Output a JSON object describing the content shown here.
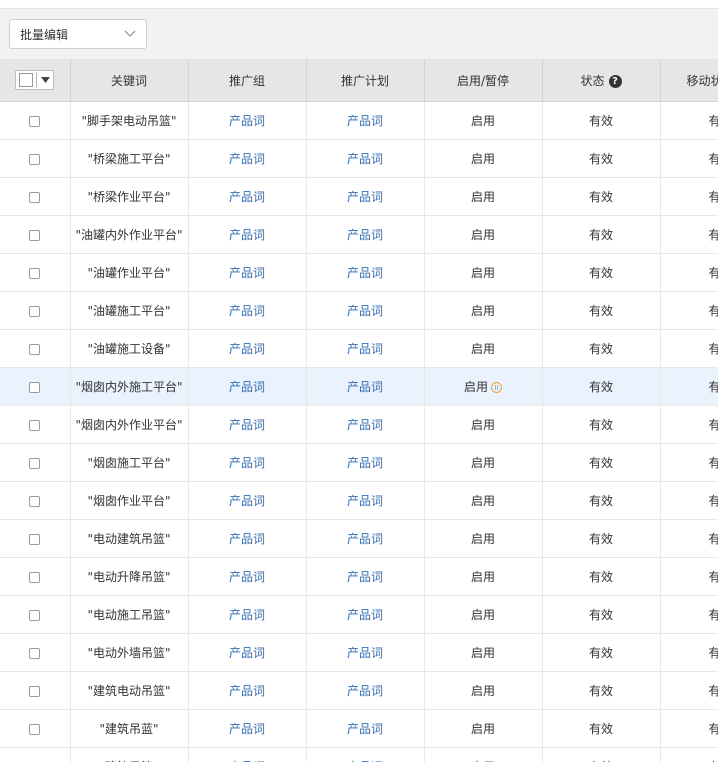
{
  "toolbar": {
    "batch_edit_label": "批量编辑"
  },
  "table": {
    "columns": [
      "关键词",
      "推广组",
      "推广计划",
      "启用/暂停",
      "状态",
      "移动状态"
    ],
    "rows": [
      {
        "keyword": "\"脚手架电动吊篮\"",
        "group": "产品词",
        "plan": "产品词",
        "enabled": "启用",
        "status": "有效",
        "mobile": "有效"
      },
      {
        "keyword": "\"桥梁施工平台\"",
        "group": "产品词",
        "plan": "产品词",
        "enabled": "启用",
        "status": "有效",
        "mobile": "有效"
      },
      {
        "keyword": "\"桥梁作业平台\"",
        "group": "产品词",
        "plan": "产品词",
        "enabled": "启用",
        "status": "有效",
        "mobile": "有效"
      },
      {
        "keyword": "\"油罐内外作业平台\"",
        "group": "产品词",
        "plan": "产品词",
        "enabled": "启用",
        "status": "有效",
        "mobile": "有效"
      },
      {
        "keyword": "\"油罐作业平台\"",
        "group": "产品词",
        "plan": "产品词",
        "enabled": "启用",
        "status": "有效",
        "mobile": "有效"
      },
      {
        "keyword": "\"油罐施工平台\"",
        "group": "产品词",
        "plan": "产品词",
        "enabled": "启用",
        "status": "有效",
        "mobile": "有效"
      },
      {
        "keyword": "\"油罐施工设备\"",
        "group": "产品词",
        "plan": "产品词",
        "enabled": "启用",
        "status": "有效",
        "mobile": "有效"
      },
      {
        "keyword": "\"烟囱内外施工平台\"",
        "group": "产品词",
        "plan": "产品词",
        "enabled": "启用",
        "status": "有效",
        "mobile": "有效"
      },
      {
        "keyword": "\"烟囱内外作业平台\"",
        "group": "产品词",
        "plan": "产品词",
        "enabled": "启用",
        "status": "有效",
        "mobile": "有效"
      },
      {
        "keyword": "\"烟囱施工平台\"",
        "group": "产品词",
        "plan": "产品词",
        "enabled": "启用",
        "status": "有效",
        "mobile": "有效"
      },
      {
        "keyword": "\"烟囱作业平台\"",
        "group": "产品词",
        "plan": "产品词",
        "enabled": "启用",
        "status": "有效",
        "mobile": "有效"
      },
      {
        "keyword": "\"电动建筑吊篮\"",
        "group": "产品词",
        "plan": "产品词",
        "enabled": "启用",
        "status": "有效",
        "mobile": "有效"
      },
      {
        "keyword": "\"电动升降吊篮\"",
        "group": "产品词",
        "plan": "产品词",
        "enabled": "启用",
        "status": "有效",
        "mobile": "有效"
      },
      {
        "keyword": "\"电动施工吊篮\"",
        "group": "产品词",
        "plan": "产品词",
        "enabled": "启用",
        "status": "有效",
        "mobile": "有效"
      },
      {
        "keyword": "\"电动外墙吊篮\"",
        "group": "产品词",
        "plan": "产品词",
        "enabled": "启用",
        "status": "有效",
        "mobile": "有效"
      },
      {
        "keyword": "\"建筑电动吊篮\"",
        "group": "产品词",
        "plan": "产品词",
        "enabled": "启用",
        "status": "有效",
        "mobile": "有效"
      },
      {
        "keyword": "\"建筑吊蓝\"",
        "group": "产品词",
        "plan": "产品词",
        "enabled": "启用",
        "status": "有效",
        "mobile": "有效"
      },
      {
        "keyword": "\"建筑吊篮\"",
        "group": "产品词",
        "plan": "产品词",
        "enabled": "启用",
        "status": "有效",
        "mobile": "有效"
      }
    ]
  },
  "colors": {
    "link": "#2f6db5",
    "header_bg": "#e6e6e6",
    "highlight_row": "#eaf2fd",
    "pause_icon": "#f0a030"
  },
  "icons": {
    "help": "question-circle-icon",
    "pause": "pause-circle-icon",
    "dropdown": "chevron-down-icon"
  }
}
